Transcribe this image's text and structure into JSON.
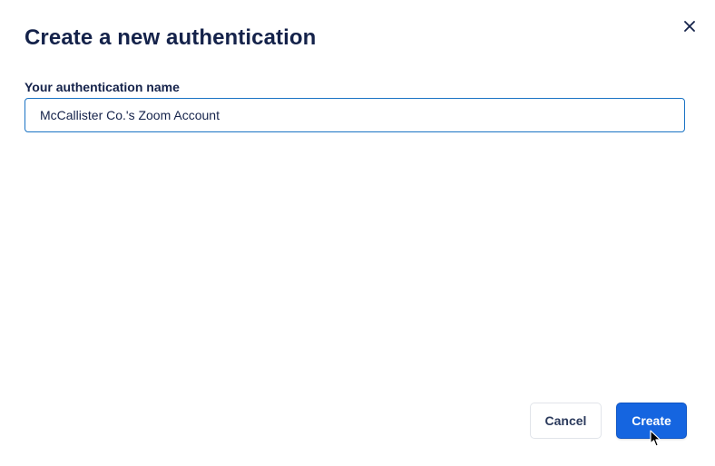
{
  "dialog": {
    "title": "Create a new authentication",
    "close_icon": "close-icon"
  },
  "form": {
    "name_label": "Your authentication name",
    "name_value": "McCallister Co.'s Zoom Account"
  },
  "footer": {
    "cancel_label": "Cancel",
    "create_label": "Create"
  },
  "colors": {
    "primary": "#1565e0",
    "text": "#14224a",
    "input_border_focus": "#1a73c4"
  }
}
